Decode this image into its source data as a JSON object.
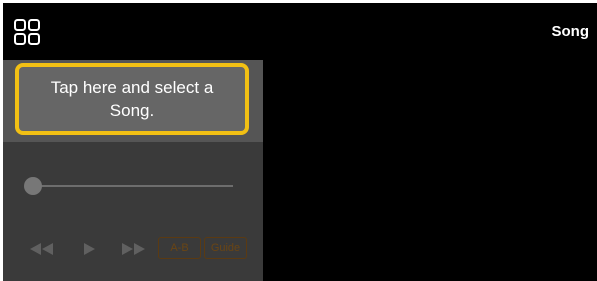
{
  "header": {
    "title": "Song",
    "menu_icon": "grid-menu-icon"
  },
  "song_select": {
    "prompt": "Tap here and select a Song."
  },
  "playback": {
    "position_fraction": 0,
    "rewind_icon": "rewind-icon",
    "play_icon": "play-icon",
    "fast_forward_icon": "fast-forward-icon",
    "ab_label": "A-B",
    "guide_label": "Guide"
  },
  "colors": {
    "highlight": "#f2c014",
    "background": "#000000",
    "panel": "#3a3a3a"
  }
}
